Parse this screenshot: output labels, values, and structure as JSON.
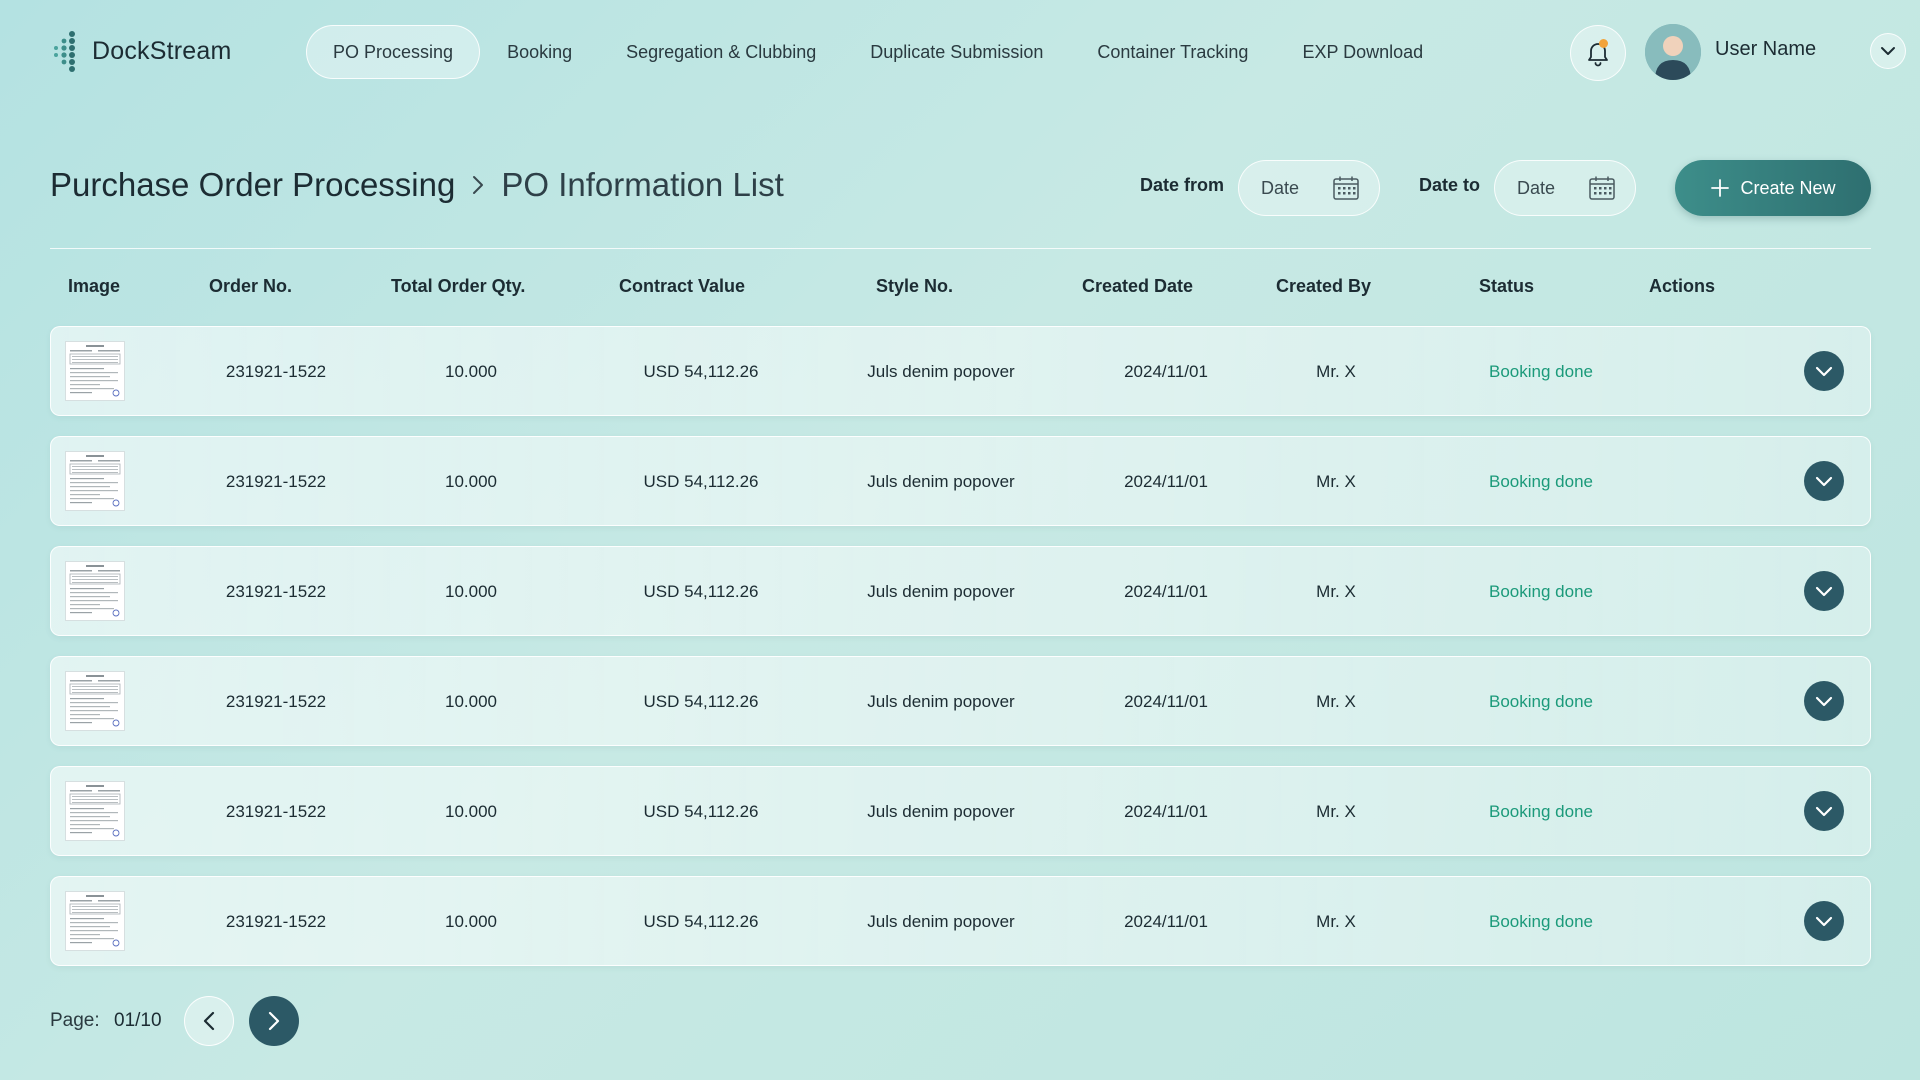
{
  "app": {
    "name": "DockStream"
  },
  "nav": {
    "items": [
      {
        "label": "PO Processing",
        "active": true
      },
      {
        "label": "Booking",
        "active": false
      },
      {
        "label": "Segregation & Clubbing",
        "active": false
      },
      {
        "label": "Duplicate Submission",
        "active": false
      },
      {
        "label": "Container Tracking",
        "active": false
      },
      {
        "label": "EXP Download",
        "active": false
      }
    ]
  },
  "user": {
    "name": "User Name",
    "has_notification": true
  },
  "header": {
    "title": "Purchase Order Processing",
    "subtitle": "PO Information List",
    "date_from_label": "Date from",
    "date_from_value": "Date",
    "date_to_label": "Date to",
    "date_to_value": "Date",
    "create_label": "Create New"
  },
  "table": {
    "columns": [
      "Image",
      "Order No.",
      "Total Order Qty.",
      "Contract Value",
      "Style No.",
      "Created Date",
      "Created By",
      "Status",
      "Actions"
    ],
    "rows": [
      {
        "order_no": "231921-1522",
        "qty": "10.000",
        "value": "USD 54,112.26",
        "style": "Juls denim popover",
        "date": "2024/11/01",
        "by": "Mr. X",
        "status": "Booking done"
      },
      {
        "order_no": "231921-1522",
        "qty": "10.000",
        "value": "USD 54,112.26",
        "style": "Juls denim popover",
        "date": "2024/11/01",
        "by": "Mr. X",
        "status": "Booking done"
      },
      {
        "order_no": "231921-1522",
        "qty": "10.000",
        "value": "USD 54,112.26",
        "style": "Juls denim popover",
        "date": "2024/11/01",
        "by": "Mr. X",
        "status": "Booking done"
      },
      {
        "order_no": "231921-1522",
        "qty": "10.000",
        "value": "USD 54,112.26",
        "style": "Juls denim popover",
        "date": "2024/11/01",
        "by": "Mr. X",
        "status": "Booking done"
      },
      {
        "order_no": "231921-1522",
        "qty": "10.000",
        "value": "USD 54,112.26",
        "style": "Juls denim popover",
        "date": "2024/11/01",
        "by": "Mr. X",
        "status": "Booking done"
      },
      {
        "order_no": "231921-1522",
        "qty": "10.000",
        "value": "USD 54,112.26",
        "style": "Juls denim popover",
        "date": "2024/11/01",
        "by": "Mr. X",
        "status": "Booking done"
      }
    ]
  },
  "pagination": {
    "label": "Page:",
    "value": "01/10"
  },
  "colors": {
    "accent": "#2e6f70",
    "status_green": "#1b9a7a",
    "dark_button": "#2c5966",
    "notification": "#f2a33a"
  },
  "icons": {
    "bell": "bell-icon",
    "calendar": "calendar-icon",
    "plus": "plus-icon",
    "chevron_down": "chevron-down-icon",
    "chevron_left": "chevron-left-icon",
    "chevron_right": "chevron-right-icon"
  }
}
